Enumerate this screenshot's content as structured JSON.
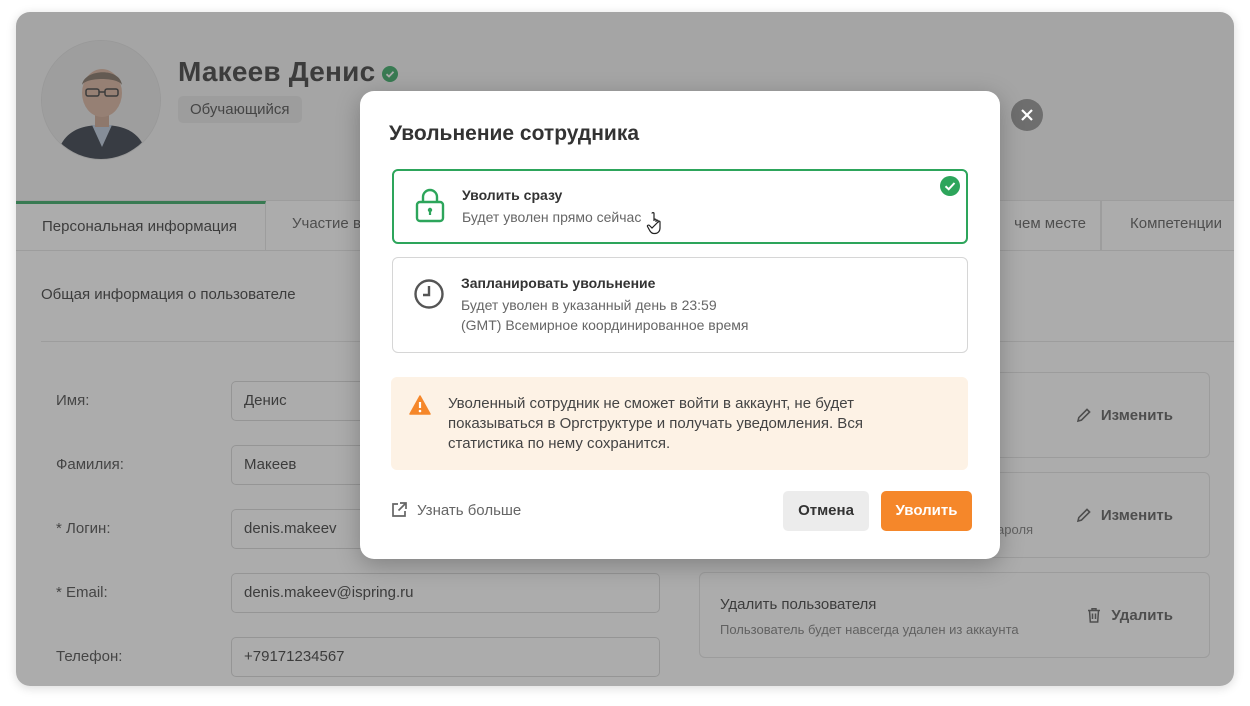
{
  "profile": {
    "name": "Макеев Денис",
    "role": "Обучающийся"
  },
  "tabs": [
    {
      "label": "Персональная информация"
    },
    {
      "label": "Участие в"
    },
    {
      "label": "чем месте"
    },
    {
      "label": "Компетенции"
    }
  ],
  "main": {
    "section_title": "Общая информация о пользователе",
    "fields": [
      {
        "label": "Имя:",
        "value": "Денис"
      },
      {
        "label": "Фамилия:",
        "value": "Макеев"
      },
      {
        "label": "* Логин:",
        "value": "denis.makeev"
      },
      {
        "label": "* Email:",
        "value": "denis.makeev@ispring.ru"
      },
      {
        "label": "Телефон:",
        "value": "+79171234567"
      }
    ]
  },
  "cards": {
    "edit_label": "Изменить",
    "password_desc_fragment": "пароля",
    "delete_title": "Удалить пользователя",
    "delete_desc": "Пользователь будет навсегда удален из аккаунта",
    "delete_label": "Удалить"
  },
  "modal": {
    "title": "Увольнение сотрудника",
    "option_now": {
      "title": "Уволить сразу",
      "desc": "Будет уволен прямо сейчас"
    },
    "option_scheduled": {
      "title": "Запланировать увольнение",
      "desc1": "Будет уволен в указанный день в 23:59",
      "desc2": "(GMT) Всемирное координированное время"
    },
    "warning": "Уволенный сотрудник не сможет войти в аккаунт, не будет показываться в Оргструктуре и получать уведомления. Вся статистика по нему сохранится.",
    "learn_more": "Узнать больше",
    "cancel": "Отмена",
    "confirm": "Уволить"
  },
  "colors": {
    "accent_green": "#2da55b",
    "primary_orange": "#f5872a",
    "warning_bg": "#fdf2e5"
  }
}
